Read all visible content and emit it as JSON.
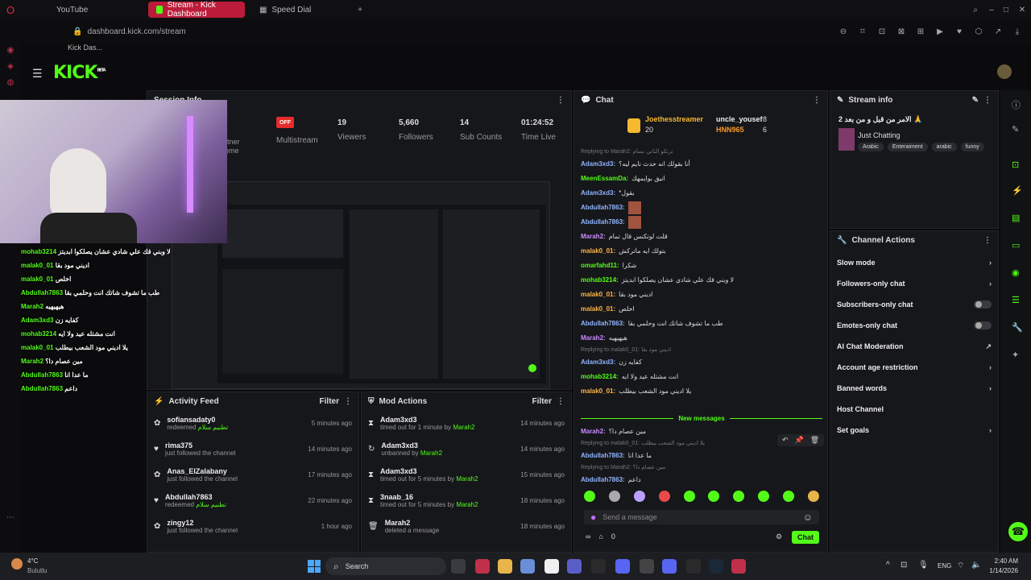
{
  "browser": {
    "tabs": [
      {
        "label": "YouTube"
      },
      {
        "label": "Stream - Kick Dashboard"
      },
      {
        "label": "Speed Dial"
      }
    ],
    "url": "dashboard.kick.com/stream",
    "side_tab_label": "Kick Das..."
  },
  "kick": {
    "logo": "KICK",
    "logo_sup": "BETA"
  },
  "session": {
    "title": "Session Info",
    "offline_badge": "OFF",
    "stats": [
      {
        "value": "",
        "label": "Multistream"
      },
      {
        "value": "19",
        "label": "Viewers"
      },
      {
        "value": "5,660",
        "label": "Followers"
      },
      {
        "value": "14",
        "label": "Sub Counts"
      },
      {
        "value": "01:24:52",
        "label": "Time Live"
      }
    ],
    "partial_labels": [
      "rtner",
      "ome"
    ]
  },
  "activity": {
    "title": "Activity Feed",
    "filter": "Filter",
    "items": [
      {
        "name": "sofiansadaty0",
        "sub": "redeemed",
        "extra": "تطنيم سلام",
        "time": "5 minutes ago"
      },
      {
        "name": "rima375",
        "sub": "just followed the channel",
        "extra": "",
        "time": "14 minutes ago"
      },
      {
        "name": "Anas_ElZalabany",
        "sub": "just followed the channel",
        "extra": "",
        "time": "17 minutes ago"
      },
      {
        "name": "Abdullah7863",
        "sub": "redeemed",
        "extra": "تطنيم سلام",
        "time": "22 minutes ago"
      },
      {
        "name": "zingy12",
        "sub": "just followed the channel",
        "extra": "",
        "time": "1 hour ago"
      }
    ]
  },
  "mod": {
    "title": "Mod Actions",
    "filter": "Filter",
    "items": [
      {
        "name": "Adam3xd3",
        "sub": "timed out for 1 minute by",
        "by": "Marah2",
        "time": "14 minutes ago"
      },
      {
        "name": "Adam3xd3",
        "sub": "unbanned by",
        "by": "Marah2",
        "time": "14 minutes ago"
      },
      {
        "name": "Adam3xd3",
        "sub": "timed out for 5 minutes by",
        "by": "Marah2",
        "time": "15 minutes ago"
      },
      {
        "name": "3naab_16",
        "sub": "timed out for 5 minutes by",
        "by": "Marah2",
        "time": "18 minutes ago"
      },
      {
        "name": "Marah2",
        "sub": "deleted a message",
        "by": "",
        "time": "18 minutes ago"
      }
    ]
  },
  "chat": {
    "title": "Chat",
    "top": [
      {
        "name": "Joethesstreamer",
        "count": "20"
      },
      {
        "name": "uncle_yousef",
        "count": "8"
      },
      {
        "name": "HNN965",
        "count": "6"
      }
    ],
    "messages": [
      {
        "reply": "Replying to Marah2: ترتكو الثاني نسام",
        "user": "Adam3xd3:",
        "text": "أنا بقولك انه حدث نايم ليه؟",
        "color": "b"
      },
      {
        "reply": "",
        "user": "MeenEssamDa:",
        "text": "انيق بوايمهك",
        "color": "g"
      },
      {
        "reply": "",
        "user": "Adam3xd3:",
        "text": "*بقول",
        "color": "b"
      },
      {
        "reply": "",
        "user": "Abdullah7863:",
        "text": "",
        "color": "b"
      },
      {
        "reply": "",
        "user": "Abdullah7863:",
        "text": "",
        "color": "b"
      },
      {
        "reply": "",
        "user": "Marah2:",
        "text": "قلت لوتكنس قال تمام",
        "color": "p"
      },
      {
        "reply": "",
        "user": "malak0_01:",
        "text": "بتولك ايه ماتركش",
        "color": "o"
      },
      {
        "reply": "",
        "user": "omarfahd11:",
        "text": "شكرا",
        "color": "g"
      },
      {
        "reply": "",
        "user": "mohab3214:",
        "text": "لا وبني قك علي شادي عشان يصلكوا ابديتز",
        "color": "g"
      },
      {
        "reply": "",
        "user": "malak0_01:",
        "text": "اديني مود بقا",
        "color": "o"
      },
      {
        "reply": "",
        "user": "malak0_01:",
        "text": "اخلص",
        "color": "o"
      },
      {
        "reply": "",
        "user": "Abdullah7863:",
        "text": "طب ما تشوف شاتك انت وحلمي بقا",
        "color": "b"
      },
      {
        "reply": "",
        "user": "Marah2:",
        "text": "هيهيهيه",
        "color": "p"
      },
      {
        "reply": "Replying to malak0_01: اديني مود بقا",
        "user": "Adam3xd3:",
        "text": "كفايه زن",
        "color": "b"
      },
      {
        "reply": "",
        "user": "mohab3214:",
        "text": "انت مشتله عيد ولا ايه",
        "color": "g"
      },
      {
        "reply": "",
        "user": "malak0_01:",
        "text": "يلا اديني مود الشعب بيطلب",
        "color": "o"
      }
    ],
    "new_messages": "New messages",
    "after": [
      {
        "reply": "",
        "user": "Marah2:",
        "text": "مين عصام دا؟",
        "color": "p"
      },
      {
        "reply": "Replying to malak0_01: يلا اديني مود الشعب بيطلب",
        "user": "Abdullah7863:",
        "text": "ما عدا انا",
        "color": "b"
      },
      {
        "reply": "Replying to Marah2: مين عصام دا؟",
        "user": "Abdullah7863:",
        "text": "داعم",
        "color": "b"
      }
    ],
    "placeholder": "Send a message",
    "count": "0",
    "send": "Chat"
  },
  "stream": {
    "title": "Stream info",
    "stream_title": "الامر من قبل و من بعد 2 🙏",
    "category": "Just Chatting",
    "tags": [
      "Arabic",
      "Enteraiment",
      "arabic",
      "funny"
    ]
  },
  "actions": {
    "title": "Channel Actions",
    "items": [
      {
        "label": "Slow mode",
        "kind": "chev"
      },
      {
        "label": "Followers-only chat",
        "kind": "chev"
      },
      {
        "label": "Subscribers-only chat",
        "kind": "toggle"
      },
      {
        "label": "Emotes-only chat",
        "kind": "toggle"
      },
      {
        "label": "AI Chat Moderation",
        "kind": "ext"
      },
      {
        "label": "Account age restriction",
        "kind": "chev"
      },
      {
        "label": "Banned words",
        "kind": "chev"
      },
      {
        "label": "Host Channel",
        "kind": "none"
      },
      {
        "label": "Set goals",
        "kind": "chev"
      }
    ]
  },
  "overlay_chat": [
    {
      "user": "mohab3214",
      "text": "لا وبني قك علي شادي عشان يصلكوا ابديتز"
    },
    {
      "user": "malak0_01",
      "text": "اديني مود بقا"
    },
    {
      "user": "malak0_01",
      "text": "اخلص"
    },
    {
      "user": "Abdullah7863",
      "text": "طب ما تشوف شاتك انت وحلمي بقا"
    },
    {
      "user": "Marah2",
      "text": "هيهيهيه"
    },
    {
      "user": "Adam3xd3",
      "text": "كفايه زن"
    },
    {
      "user": "mohab3214",
      "text": "انت مشتله عيد ولا ايه"
    },
    {
      "user": "malak0_01",
      "text": "يلا اديني مود الشعب بيطلب"
    },
    {
      "user": "Marah2",
      "text": "مين عصام دا؟"
    },
    {
      "user": "Abdullah7863",
      "text": "ما عدا انا"
    },
    {
      "user": "Abdullah7863",
      "text": "داعم"
    }
  ],
  "taskbar": {
    "weather_temp": "4°C",
    "weather_desc": "Bulutlu",
    "search": "Search",
    "lang": "ENG",
    "time": "2:40 AM",
    "date": "1/14/2026"
  },
  "colors": {
    "accent": "#53fc18",
    "opera_red": "#bc1c3a"
  }
}
